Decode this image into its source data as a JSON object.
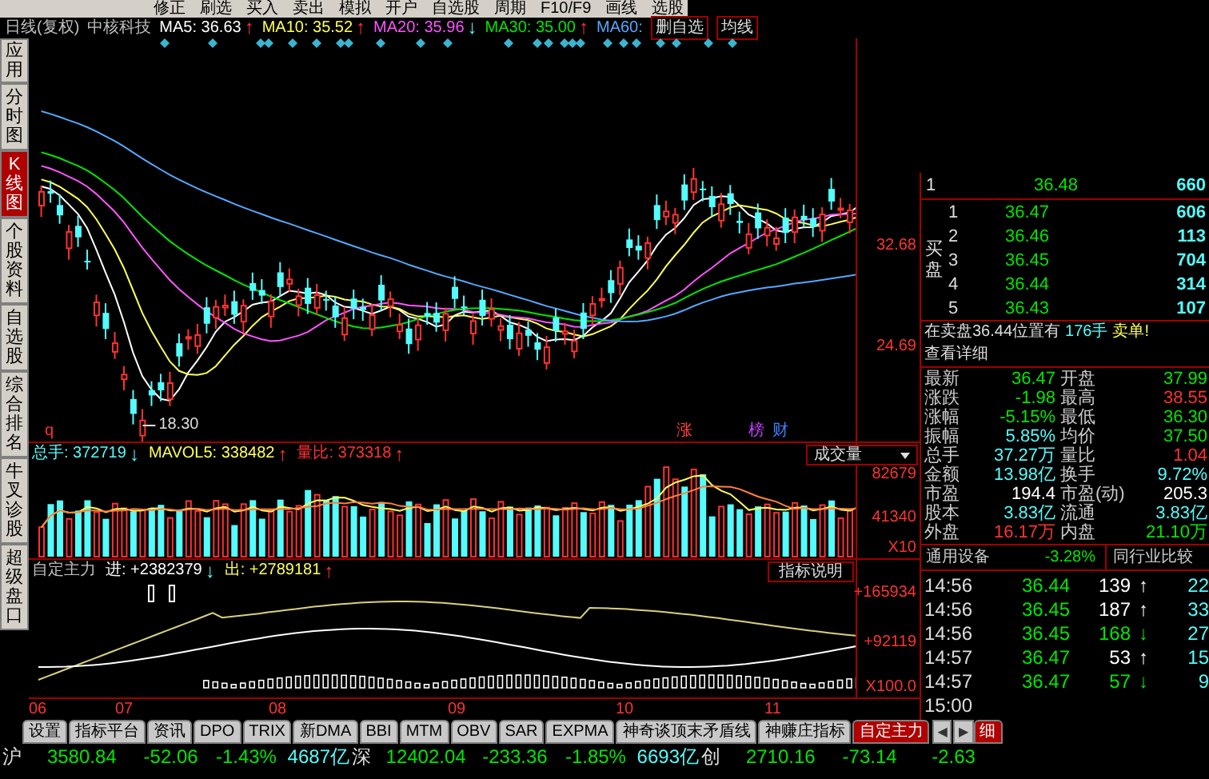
{
  "menu_bar": {
    "items": [
      "修正",
      "刷选",
      "买入",
      "卖出",
      "模拟",
      "开户",
      "自选股",
      "周期",
      "F10/F9",
      "画线",
      "选股"
    ]
  },
  "chart_header": {
    "period": "日线(复权)",
    "stock": "中核科技",
    "moving_averages": [
      {
        "label": "MA5: 36.63",
        "arrow": "↑",
        "rising": true,
        "color": "#ffffff"
      },
      {
        "label": "MA10: 35.52",
        "arrow": "↑",
        "rising": true,
        "color": "#ffff54"
      },
      {
        "label": "MA20: 35.96",
        "arrow": "↓",
        "rising": false,
        "color": "#ff54ff"
      },
      {
        "label": "MA30: 35.00",
        "arrow": "↑",
        "rising": true,
        "color": "#00e600"
      },
      {
        "label": "MA60:",
        "color": "#54a8ff"
      }
    ],
    "buttons": [
      "删自选",
      "均线"
    ]
  },
  "side_tabs": [
    {
      "label": "应用",
      "selected": false
    },
    {
      "label": "分时图",
      "selected": false
    },
    {
      "label": "K线图",
      "selected": true
    },
    {
      "label": "个股资料",
      "selected": false
    },
    {
      "label": "自选股",
      "selected": false
    },
    {
      "label": "综合排名",
      "selected": false
    },
    {
      "label": "牛叉诊股",
      "selected": false
    },
    {
      "label": "超级盘口",
      "selected": false
    }
  ],
  "price_chart": {
    "axis_labels": [
      "32.68",
      "24.69"
    ],
    "low_label": "18.30",
    "corner_mark": "q",
    "event_tags": [
      {
        "label": "涨",
        "color": "#ff4040"
      },
      {
        "label": "榜",
        "color": "#c040ff"
      },
      {
        "label": "财",
        "color": "#4080ff"
      }
    ]
  },
  "volume_panel": {
    "readings": [
      {
        "label": "总手: 372719",
        "arrow": "↓",
        "rising": false,
        "color": "#54fcfc"
      },
      {
        "label": "MAVOL5: 338482",
        "arrow": "↑",
        "rising": true,
        "color": "#ffff54"
      },
      {
        "label": "量比: 373318",
        "arrow": "↑",
        "rising": true,
        "color": "#ff3232"
      }
    ],
    "dropdown": "成交量",
    "axis_labels": [
      "82679",
      "41340",
      "X10"
    ]
  },
  "indicator_panel": {
    "name": "自定主力",
    "readings": [
      {
        "label": "进: +2382379",
        "arrow": "↓",
        "rising": false,
        "color": "#ffffff"
      },
      {
        "label": "出: +2789181",
        "arrow": "↑",
        "rising": true,
        "color": "#ffff54"
      }
    ],
    "button": "指标说明",
    "axis_labels": [
      "+165934",
      "+92119",
      "X100.0"
    ]
  },
  "date_labels": [
    "06",
    "07",
    "08",
    "09",
    "10",
    "11"
  ],
  "indicator_tabs": [
    {
      "label": "设置",
      "selected": false
    },
    {
      "label": "指标平台",
      "selected": false
    },
    {
      "label": "资讯",
      "selected": false
    },
    {
      "label": "DPO",
      "selected": false
    },
    {
      "label": "TRIX",
      "selected": false
    },
    {
      "label": "新DMA",
      "selected": false
    },
    {
      "label": "BBI",
      "selected": false
    },
    {
      "label": "MTM",
      "selected": false
    },
    {
      "label": "OBV",
      "selected": false
    },
    {
      "label": "SAR",
      "selected": false
    },
    {
      "label": "EXPMA",
      "selected": false
    },
    {
      "label": "神奇谈顶末矛盾线",
      "selected": false
    },
    {
      "label": "神赚庄指标",
      "selected": false
    },
    {
      "label": "自定主力",
      "selected": true
    }
  ],
  "scroll_buttons": [
    "◀",
    "▶"
  ],
  "detail_tab": {
    "label": "细",
    "selected": true
  },
  "order_book": {
    "sell": [
      {
        "level": "1",
        "price": "36.48",
        "volume": "660"
      }
    ],
    "buy_label": "买盘",
    "buy": [
      {
        "level": "1",
        "price": "36.47",
        "volume": "606"
      },
      {
        "level": "2",
        "price": "36.46",
        "volume": "113"
      },
      {
        "level": "3",
        "price": "36.45",
        "volume": "704"
      },
      {
        "level": "4",
        "price": "36.44",
        "volume": "314"
      },
      {
        "level": "5",
        "price": "36.43",
        "volume": "107"
      }
    ]
  },
  "order_notice": {
    "text": "在卖盘36.44位置有",
    "amount": "176手",
    "action": "卖单!",
    "link": "查看详细"
  },
  "quote_stats": [
    {
      "label": "最新",
      "value": "36.47",
      "color": "#00e600"
    },
    {
      "label": "开盘",
      "value": "37.99",
      "color": "#00e600"
    },
    {
      "label": "涨跌",
      "value": "-1.98",
      "color": "#00e600"
    },
    {
      "label": "最高",
      "value": "38.55",
      "color": "#ff3232"
    },
    {
      "label": "涨幅",
      "value": "-5.15%",
      "color": "#00e600"
    },
    {
      "label": "最低",
      "value": "36.30",
      "color": "#00e600"
    },
    {
      "label": "振幅",
      "value": "5.85%",
      "color": "#54fcfc"
    },
    {
      "label": "均价",
      "value": "37.50",
      "color": "#00e600"
    },
    {
      "label": "总手",
      "value": "37.27万",
      "color": "#54fcfc"
    },
    {
      "label": "量比",
      "value": "1.04",
      "color": "#ff3232"
    },
    {
      "label": "金额",
      "value": "13.98亿",
      "color": "#54fcfc"
    },
    {
      "label": "换手",
      "value": "9.72%",
      "color": "#54fcfc"
    },
    {
      "label": "市盈",
      "value": "194.4",
      "color": "#ffffff"
    },
    {
      "label": "市盈(动)",
      "value": "205.3",
      "color": "#ffffff"
    },
    {
      "label": "股本",
      "value": "3.83亿",
      "color": "#54fcfc"
    },
    {
      "label": "流通",
      "value": "3.83亿",
      "color": "#54fcfc"
    },
    {
      "label": "外盘",
      "value": "16.17万",
      "color": "#ff3232"
    },
    {
      "label": "内盘",
      "value": "21.10万",
      "color": "#00e600"
    }
  ],
  "industry": {
    "name": "通用设备",
    "change": "-3.28%",
    "button": "同行业比较"
  },
  "ticks": [
    {
      "time": "14:56",
      "price": "36.44",
      "volume": "139",
      "arrow": "↑",
      "color": "#ffffff",
      "column_4": "22"
    },
    {
      "time": "14:56",
      "price": "36.45",
      "volume": "187",
      "arrow": "↑",
      "color": "#ffffff",
      "column_4": "33"
    },
    {
      "time": "14:56",
      "price": "36.45",
      "volume": "168",
      "arrow": "↓",
      "color": "#00e600",
      "column_4": "27"
    },
    {
      "time": "14:57",
      "price": "36.47",
      "volume": "53",
      "arrow": "↑",
      "color": "#ffffff",
      "column_4": "15"
    },
    {
      "time": "14:57",
      "price": "36.47",
      "volume": "57",
      "arrow": "↓",
      "color": "#00e600",
      "column_4": "9"
    },
    {
      "time": "15:00"
    }
  ],
  "index_bar": [
    {
      "name": "沪",
      "value": "3580.84",
      "change": "-52.06",
      "percent": "-1.43%",
      "amount": "4687亿"
    },
    {
      "name": "深",
      "value": "12402.04",
      "change": "-233.36",
      "percent": "-1.85%",
      "amount": "6693亿"
    },
    {
      "name": "创",
      "value": "2710.16",
      "change": "-73.14",
      "percent": "-2.63"
    }
  ]
}
